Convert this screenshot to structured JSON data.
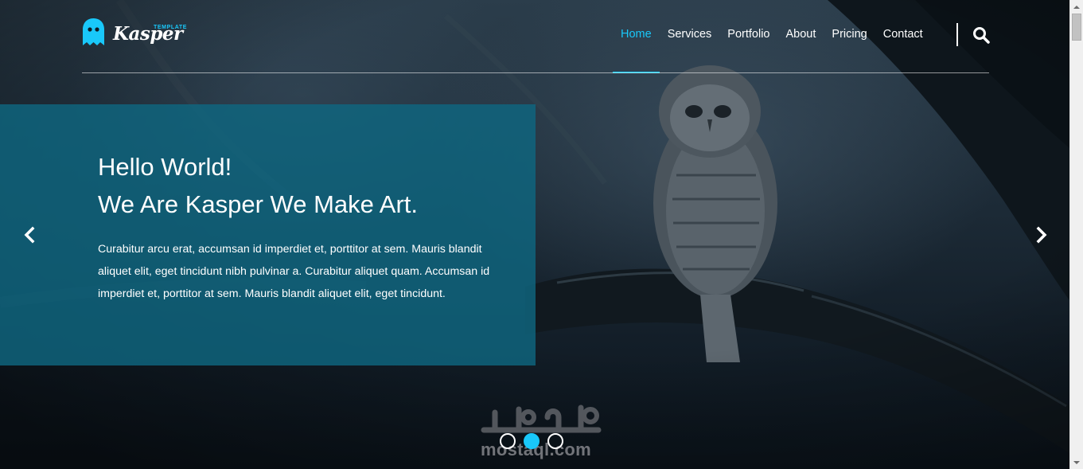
{
  "brand": {
    "wordmark": "Kasper",
    "tagline": "TEMPLATE",
    "accent_color": "#19c8fa",
    "logo_icon": "ghost-icon"
  },
  "nav": {
    "items": [
      {
        "label": "Home",
        "active": true
      },
      {
        "label": "Services",
        "active": false
      },
      {
        "label": "Portfolio",
        "active": false
      },
      {
        "label": "About",
        "active": false
      },
      {
        "label": "Pricing",
        "active": false
      },
      {
        "label": "Contact",
        "active": false
      }
    ],
    "search_icon": "search-icon"
  },
  "hero": {
    "heading_line1": "Hello World!",
    "heading_line2": "We Are Kasper We Make Art.",
    "text": "Curabitur arcu erat, accumsan id imperdiet et, porttitor at sem. Mauris blandit aliquet elit, eget tincidunt nibh pulvinar a. Curabitur aliquet quam. Accumsan id imperdiet et, porttitor at sem. Mauris blandit aliquet elit, eget tincidunt.",
    "panel_color": "#0f6680",
    "prev_icon": "chevron-left-icon",
    "next_icon": "chevron-right-icon"
  },
  "slider": {
    "slide_count": 3,
    "active_index": 1
  },
  "watermark": {
    "arabic": "مستقل",
    "latin": "mostaql.com"
  }
}
